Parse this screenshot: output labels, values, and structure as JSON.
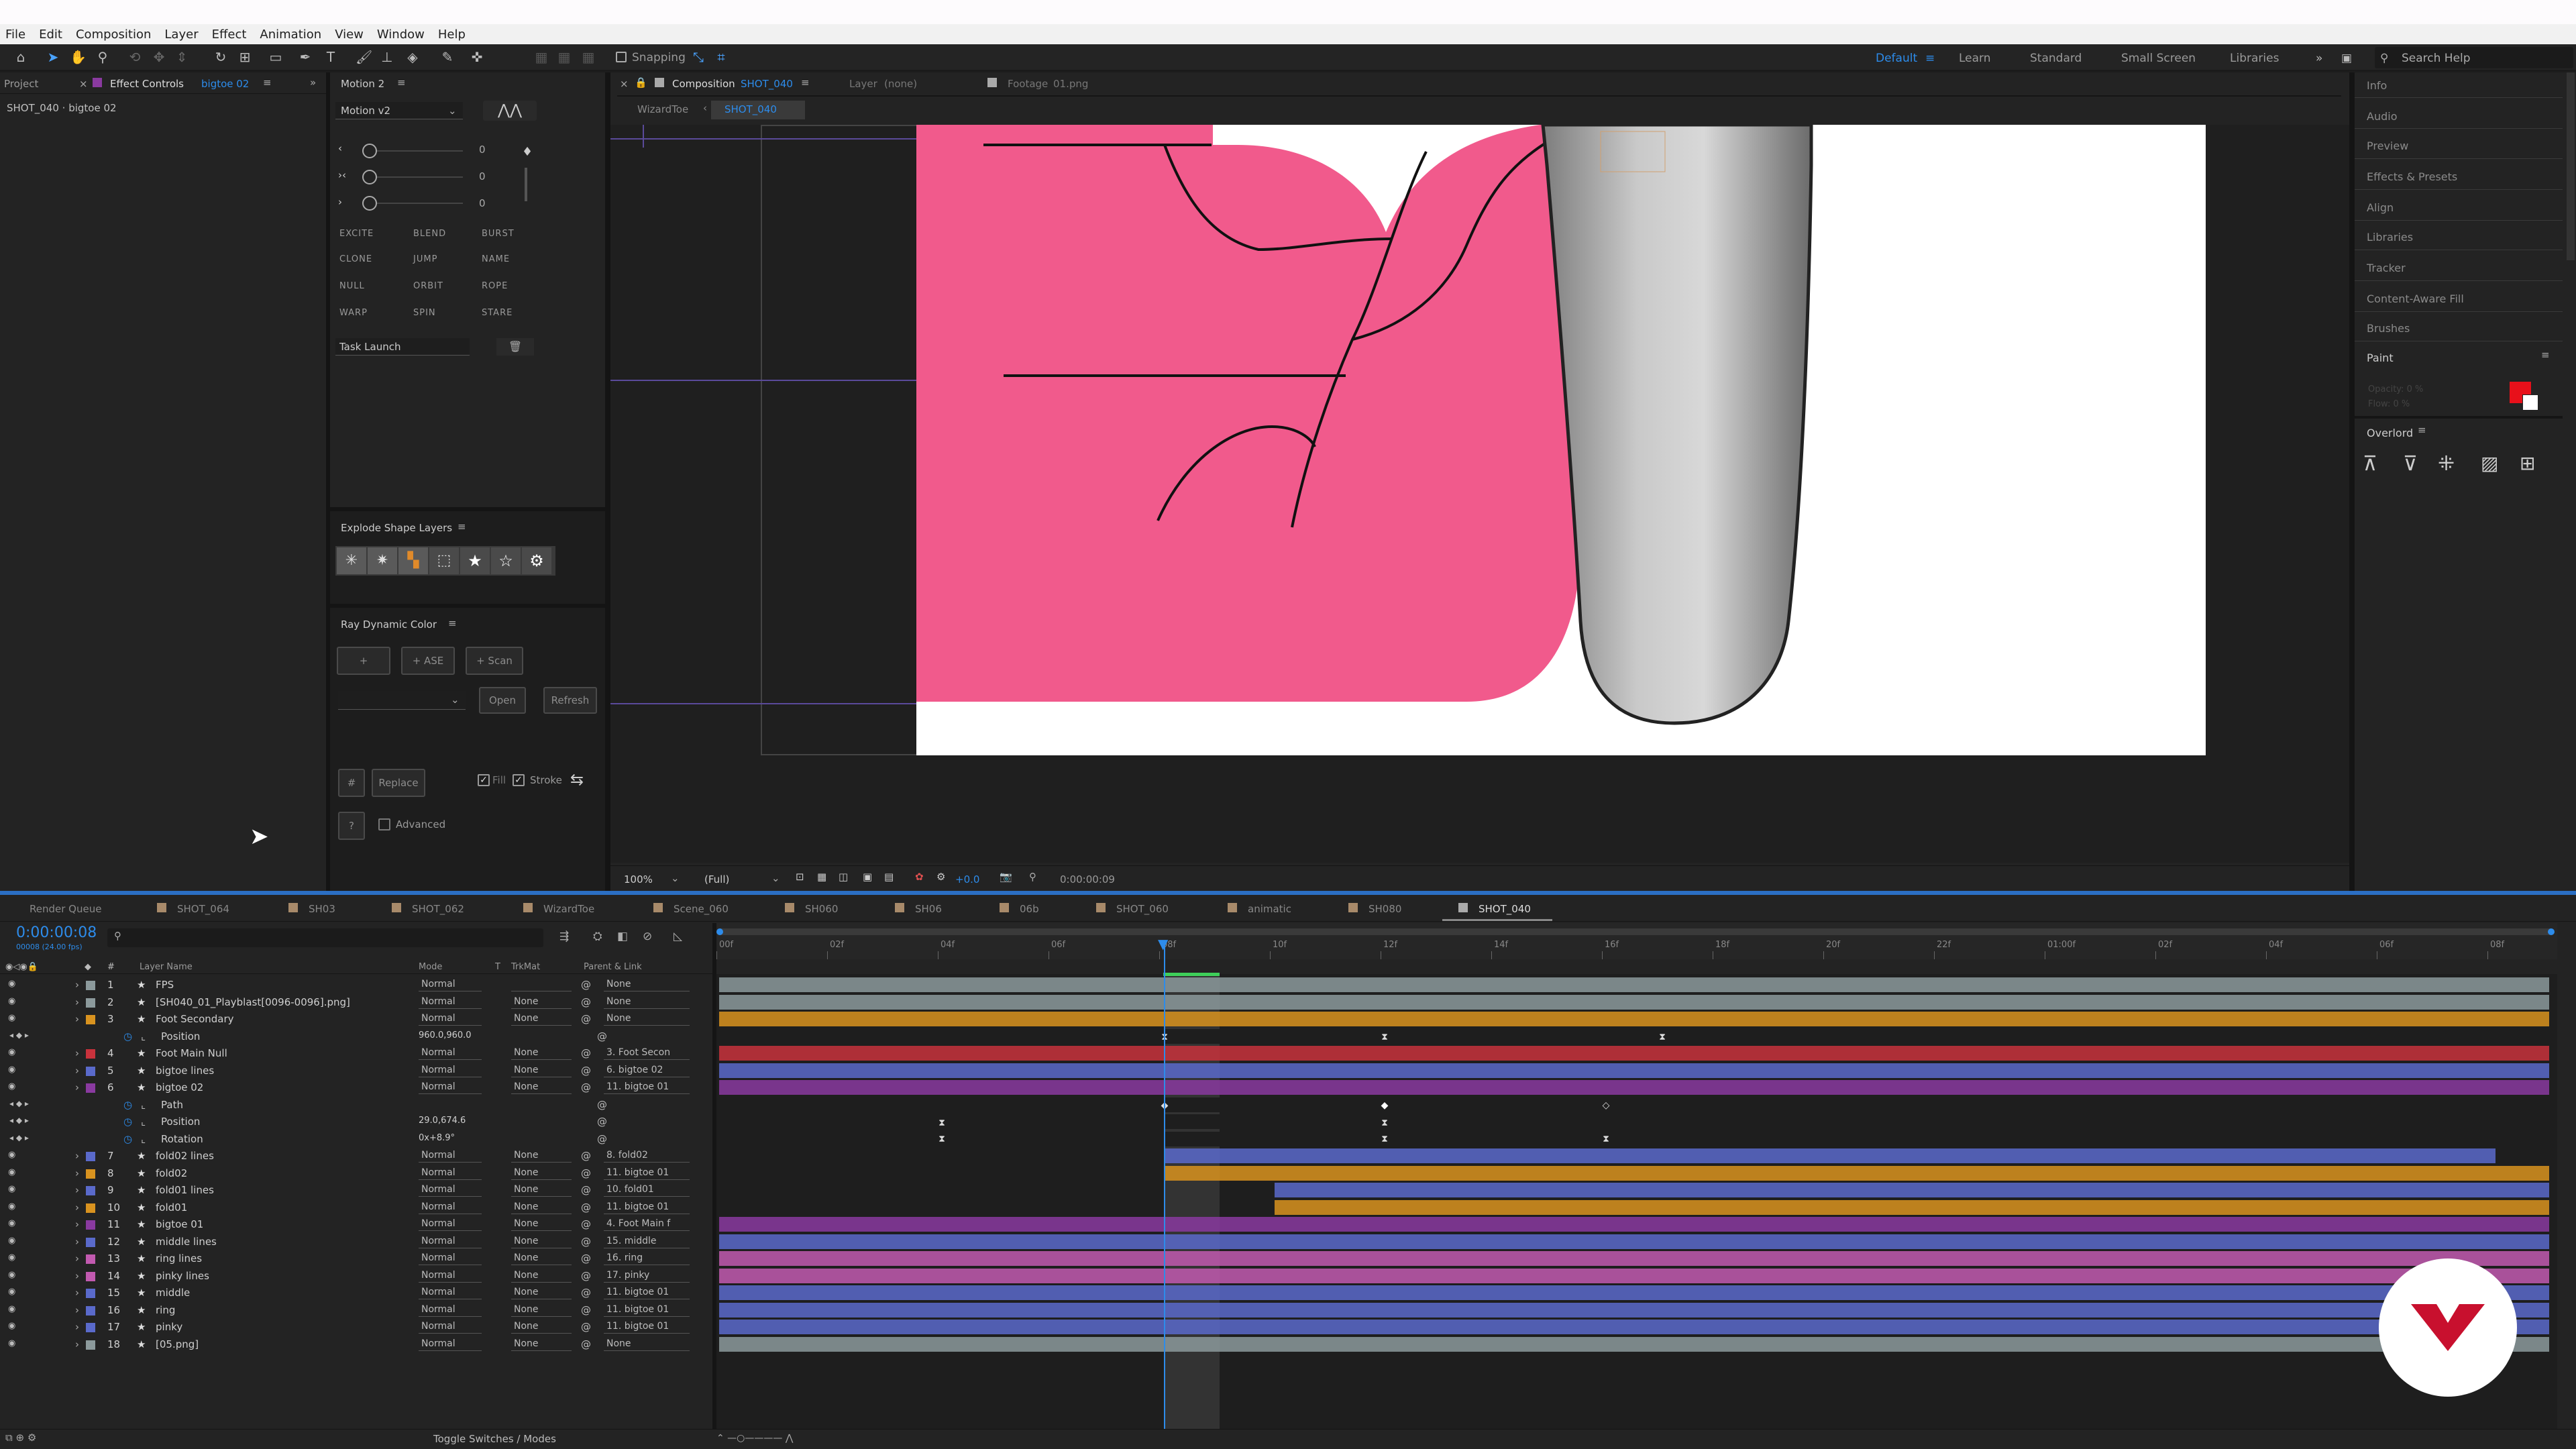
{
  "menu": [
    "File",
    "Edit",
    "Composition",
    "Layer",
    "Effect",
    "Animation",
    "View",
    "Window",
    "Help"
  ],
  "toolbar": {
    "snapping_label": "Snapping",
    "workspaces": [
      "Default",
      "Learn",
      "Standard",
      "Small Screen",
      "Libraries"
    ],
    "active_workspace": "Default",
    "search_placeholder": "Search Help"
  },
  "left_panel": {
    "tabs": [
      "Project",
      "Effect Controls",
      "bigtoe 02"
    ],
    "subtitle": "SHOT_040 · bigtoe 02"
  },
  "motion_panel": {
    "title": "Motion 2",
    "preset": "Motion v2",
    "slider_values": [
      "0",
      "0",
      "0"
    ],
    "buttons": [
      "EXCITE",
      "BLEND",
      "BURST",
      "CLONE",
      "JUMP",
      "NAME",
      "NULL",
      "ORBIT",
      "ROPE",
      "WARP",
      "SPIN",
      "STARE"
    ],
    "task": "Task Launch"
  },
  "explode_panel": {
    "title": "Explode Shape Layers"
  },
  "ray_panel": {
    "title": "Ray Dynamic Color",
    "btn_plus": "+",
    "btn_ase": "+ ASE",
    "btn_scan": "+ Scan",
    "btn_open": "Open",
    "btn_refresh": "Refresh",
    "btn_hash": "#",
    "btn_replace": "Replace",
    "fill_label": "Fill",
    "stroke_label": "Stroke",
    "btn_q": "?",
    "advanced_label": "Advanced"
  },
  "composition": {
    "tab_label": "Composition",
    "tab_name": "SHOT_040",
    "layer_label": "Layer",
    "layer_value": "(none)",
    "footage_label": "Footage",
    "footage_value": "01.png",
    "breadcrumb": [
      "WizardToe",
      "SHOT_040"
    ],
    "zoom": "100%",
    "resolution": "(Full)",
    "exposure": "+0.0",
    "timecode": "0:00:00:09"
  },
  "right_panel": {
    "items": [
      "Info",
      "Audio",
      "Preview",
      "Effects & Presets",
      "Align",
      "Libraries",
      "Tracker",
      "Content-Aware Fill",
      "Brushes"
    ],
    "paint_title": "Paint",
    "paint_opacity": "Opacity: 0 %",
    "paint_flow": "Flow: 0 %",
    "paint_color": "#e8101a",
    "overlord_title": "Overlord"
  },
  "timeline": {
    "tabs": [
      "Render Queue",
      "SHOT_064",
      "SH03",
      "SHOT_062",
      "WizardToe",
      "Scene_060",
      "SH060",
      "SH06",
      "06b",
      "SHOT_060",
      "animatic",
      "SH080",
      "SHOT_040"
    ],
    "active_tab": "SHOT_040",
    "timecode": "0:00:00:08",
    "frame_info": "00008 (24.00 fps)",
    "columns": {
      "name": "Layer Name",
      "mode": "Mode",
      "t": "T",
      "trkmat": "TrkMat",
      "parent": "Parent & Link"
    },
    "ruler": [
      "00f",
      "02f",
      "04f",
      "06f",
      "08f",
      "10f",
      "12f",
      "14f",
      "16f",
      "18f",
      "20f",
      "22f",
      "01:00f",
      "02f",
      "04f",
      "06f",
      "08f"
    ],
    "footer": "Toggle Switches / Modes",
    "layers": [
      {
        "num": "1",
        "name": "FPS",
        "mode": "Normal",
        "trk": "",
        "parent": "None",
        "color": "#8c9a9c"
      },
      {
        "num": "2",
        "name": "[SH040_01_Playblast[0096-0096].png]",
        "mode": "Normal",
        "trk": "None",
        "parent": "None",
        "color": "#8c9a9c"
      },
      {
        "num": "3",
        "name": "Foot Secondary",
        "mode": "Normal",
        "trk": "None",
        "parent": "None",
        "color": "#d9931f"
      },
      {
        "prop": true,
        "name": "Position",
        "value": "960.0,960.0"
      },
      {
        "num": "4",
        "name": "Foot Main Null",
        "mode": "Normal",
        "trk": "None",
        "parent": "3. Foot Secon",
        "color": "#c8323c"
      },
      {
        "num": "5",
        "name": "bigtoe lines",
        "mode": "Normal",
        "trk": "None",
        "parent": "6. bigtoe 02",
        "color": "#5a6acb"
      },
      {
        "num": "6",
        "name": "bigtoe 02",
        "mode": "Normal",
        "trk": "None",
        "parent": "11. bigtoe 01",
        "color": "#8a3aa0"
      },
      {
        "prop": true,
        "name": "Path",
        "value": ""
      },
      {
        "prop": true,
        "name": "Position",
        "value": "29.0,674.6"
      },
      {
        "prop": true,
        "name": "Rotation",
        "value": "0x+8.9°"
      },
      {
        "num": "7",
        "name": "fold02 lines",
        "mode": "Normal",
        "trk": "None",
        "parent": "8. fold02",
        "color": "#5a6acb"
      },
      {
        "num": "8",
        "name": "fold02",
        "mode": "Normal",
        "trk": "None",
        "parent": "11. bigtoe 01",
        "color": "#d9931f"
      },
      {
        "num": "9",
        "name": "fold01 lines",
        "mode": "Normal",
        "trk": "None",
        "parent": "10. fold01",
        "color": "#5a6acb"
      },
      {
        "num": "10",
        "name": "fold01",
        "mode": "Normal",
        "trk": "None",
        "parent": "11. bigtoe 01",
        "color": "#d9931f"
      },
      {
        "num": "11",
        "name": "bigtoe 01",
        "mode": "Normal",
        "trk": "None",
        "parent": "4. Foot Main f",
        "color": "#8a3aa0"
      },
      {
        "num": "12",
        "name": "middle lines",
        "mode": "Normal",
        "trk": "None",
        "parent": "15. middle",
        "color": "#5a6acb"
      },
      {
        "num": "13",
        "name": "ring lines",
        "mode": "Normal",
        "trk": "None",
        "parent": "16. ring",
        "color": "#c25ab0"
      },
      {
        "num": "14",
        "name": "pinky lines",
        "mode": "Normal",
        "trk": "None",
        "parent": "17. pinky",
        "color": "#c25ab0"
      },
      {
        "num": "15",
        "name": "middle",
        "mode": "Normal",
        "trk": "None",
        "parent": "11. bigtoe 01",
        "color": "#5a6acb"
      },
      {
        "num": "16",
        "name": "ring",
        "mode": "Normal",
        "trk": "None",
        "parent": "11. bigtoe 01",
        "color": "#5a6acb"
      },
      {
        "num": "17",
        "name": "pinky",
        "mode": "Normal",
        "trk": "None",
        "parent": "11. bigtoe 01",
        "color": "#5a6acb"
      },
      {
        "num": "18",
        "name": "[05.png]",
        "mode": "Normal",
        "trk": "None",
        "parent": "None",
        "color": "#8c9a9c"
      }
    ]
  }
}
